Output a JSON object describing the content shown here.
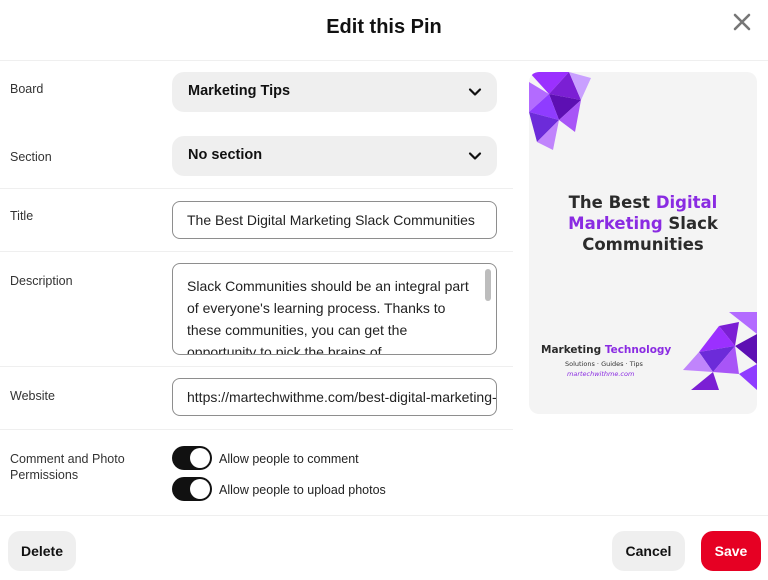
{
  "modal": {
    "title": "Edit this Pin",
    "close_icon": "close-icon"
  },
  "form": {
    "board": {
      "label": "Board",
      "value": "Marketing Tips"
    },
    "section": {
      "label": "Section",
      "value": "No section"
    },
    "title": {
      "label": "Title",
      "value": "The Best Digital Marketing Slack Communities"
    },
    "description": {
      "label": "Description",
      "value": "Slack Communities should be an integral part of everyone's learning process. Thanks to these communities, you can get the opportunity to pick the brains of"
    },
    "website": {
      "label": "Website",
      "value": "https://martechwithme.com/best-digital-marketing-slack-communities"
    },
    "permissions": {
      "label": "Comment and Photo Permissions",
      "toggles": [
        {
          "label": "Allow people to comment",
          "on": true
        },
        {
          "label": "Allow people to upload photos",
          "on": true
        }
      ]
    }
  },
  "preview": {
    "headline_part1": "The Best ",
    "headline_accent1": "Digital Marketing",
    "headline_part2": " Slack Communities",
    "brand_part1": "Marketing ",
    "brand_accent": "Technology",
    "tagline": "Solutions · Guides · Tips",
    "url": "martechwithme.com"
  },
  "actions": {
    "delete": "Delete",
    "cancel": "Cancel",
    "save": "Save"
  },
  "colors": {
    "save_red": "#e60023",
    "accent_purple": "#8a2be2",
    "toggle_on": "#111111"
  }
}
